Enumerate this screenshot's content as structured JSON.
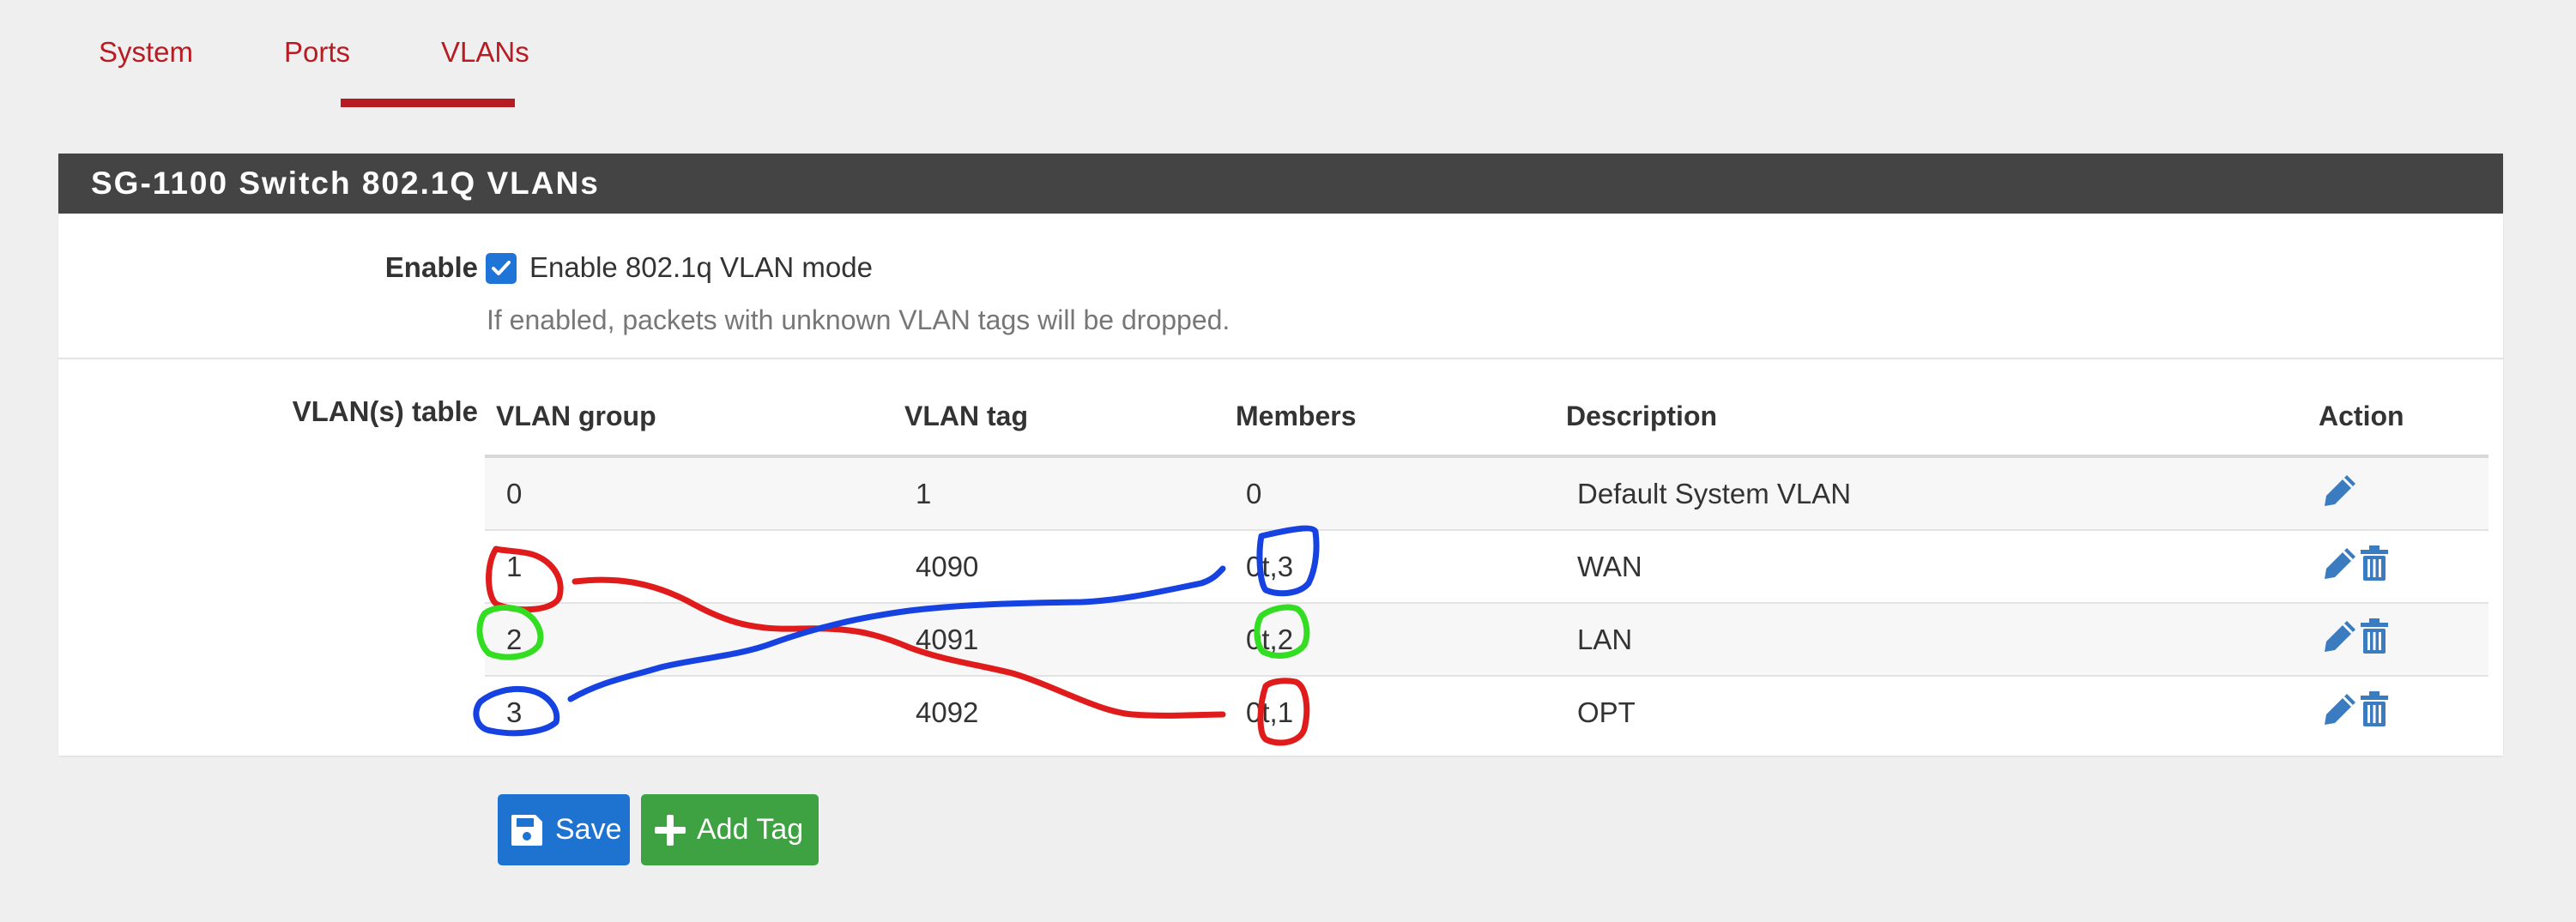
{
  "tabs": [
    {
      "label": "System"
    },
    {
      "label": "Ports"
    },
    {
      "label": "VLANs",
      "active": true
    }
  ],
  "panel": {
    "title": "SG-1100 Switch 802.1Q VLANs",
    "enable": {
      "label": "Enable",
      "checkbox_label": "Enable 802.1q VLAN mode",
      "checked": true,
      "help": "If enabled, packets with unknown VLAN tags will be dropped."
    },
    "vlan_table": {
      "label": "VLAN(s) table",
      "columns": [
        "VLAN group",
        "VLAN tag",
        "Members",
        "Description",
        "Action"
      ],
      "rows": [
        {
          "group": "0",
          "tag": "1",
          "members": "0",
          "description": "Default System VLAN",
          "actions": [
            "edit-icon"
          ]
        },
        {
          "group": "1",
          "tag": "4090",
          "members": "0t,3",
          "description": "WAN",
          "actions": [
            "edit-icon",
            "trash-icon"
          ]
        },
        {
          "group": "2",
          "tag": "4091",
          "members": "0t,2",
          "description": "LAN",
          "actions": [
            "edit-icon",
            "trash-icon"
          ]
        },
        {
          "group": "3",
          "tag": "4092",
          "members": "0t,1",
          "description": "OPT",
          "actions": [
            "edit-icon",
            "trash-icon"
          ]
        }
      ]
    }
  },
  "buttons": {
    "save": {
      "label": "Save",
      "icon": "floppy-disk-icon"
    },
    "add_tag": {
      "label": "Add Tag",
      "icon": "plus-icon"
    }
  },
  "colors": {
    "accent_red": "#b81c23",
    "panel_header": "#444444",
    "primary_blue": "#1e73d1",
    "success_green": "#3ea142",
    "action_icon": "#3b7bbf",
    "annotation_red": "#e01b1b",
    "annotation_blue": "#1542e0",
    "annotation_green": "#33dd22"
  }
}
